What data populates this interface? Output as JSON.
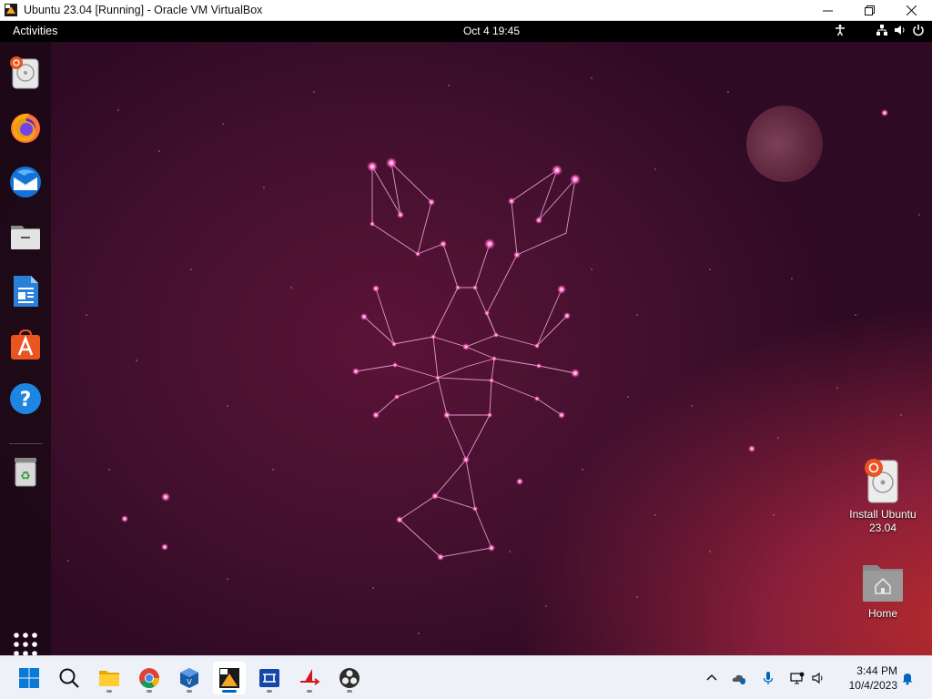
{
  "host_window": {
    "title": "Ubuntu 23.04 [Running] - Oracle VM VirtualBox",
    "icons": [
      "virtualbox-icon",
      "minimize-icon",
      "restore-icon",
      "close-icon"
    ]
  },
  "ubuntu_topbar": {
    "activities": "Activities",
    "clock": "Oct 4  19:45",
    "status_icons": [
      "accessibility-icon",
      "network-icon",
      "volume-icon",
      "power-icon"
    ]
  },
  "dock": {
    "items": [
      {
        "name": "install-ubuntu",
        "icon": "installer-disk-icon"
      },
      {
        "name": "firefox",
        "icon": "firefox-icon"
      },
      {
        "name": "thunderbird",
        "icon": "thunderbird-icon"
      },
      {
        "name": "files",
        "icon": "files-icon"
      },
      {
        "name": "libreoffice-writer",
        "icon": "writer-icon"
      },
      {
        "name": "app-center",
        "icon": "app-center-icon"
      },
      {
        "name": "help",
        "icon": "help-icon"
      },
      {
        "name": "trash",
        "icon": "trash-icon"
      },
      {
        "name": "show-apps",
        "icon": "app-grid-icon"
      }
    ]
  },
  "desktop": {
    "icons": [
      {
        "label": "Install Ubuntu 23.04",
        "icon": "installer-disk-icon"
      },
      {
        "label": "Home",
        "icon": "home-folder-icon"
      }
    ]
  },
  "taskbar": {
    "apps": [
      "start",
      "search",
      "file-explorer",
      "chrome",
      "virtualbox",
      "virtualbox-vm",
      "network-app",
      "pdf-app",
      "obs"
    ],
    "active_app": "virtualbox-vm",
    "clock_time": "3:44 PM",
    "clock_date": "10/4/2023",
    "tray_icons": [
      "chevron-up-icon",
      "onedrive-icon",
      "microphone-icon",
      "display-icon",
      "speaker-icon",
      "notification-bell-icon"
    ]
  },
  "colors": {
    "ubuntu_orange": "#e95420",
    "wallpaper_dark": "#2f0a24",
    "wallpaper_glow": "#b72b2b",
    "windows_accent": "#0067c0"
  }
}
